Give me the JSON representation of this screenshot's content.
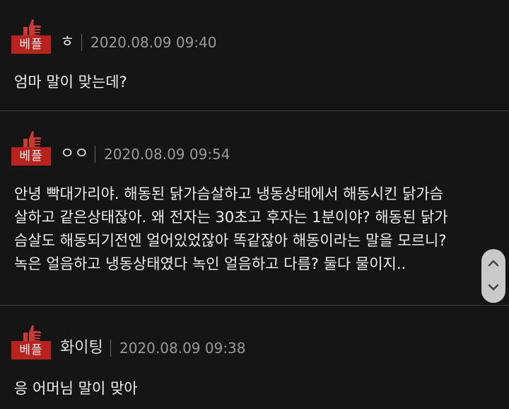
{
  "comments": [
    {
      "badge": "베플",
      "author": "ㅎ",
      "date": "2020.08.09 09:40",
      "lines": [
        "엄마 말이 맞는데?"
      ]
    },
    {
      "badge": "베플",
      "author": "ㅇㅇ",
      "date": "2020.08.09 09:54",
      "lines": [
        "안녕 빡대가리야. 해동된 닭가슴살하고 냉동상태에서 해동시킨 닭가슴",
        "살하고 같은상태잖아. 왜 전자는 30초고 후자는 1분이야? 해동된 닭가",
        "슴살도 해동되기전엔 얼어있었잖아 똑같잖아 해동이라는 말을 모르니?",
        "녹은 얼음하고 냉동상태였다 녹인 얼음하고 다름? 둘다 물이지.."
      ]
    },
    {
      "badge": "베플",
      "author": "화이팅",
      "date": "2020.08.09 09:38",
      "lines": [
        "응 어머님 말이 맞아"
      ]
    }
  ],
  "icons": {
    "badge_icon": "thumbs-up-icon",
    "scroll_up": "chevron-up-icon",
    "scroll_down": "chevron-down-icon"
  },
  "colors": {
    "background": "#151515",
    "badge": "#b8231e",
    "text": "#ededed",
    "date": "#9a9a9a"
  }
}
